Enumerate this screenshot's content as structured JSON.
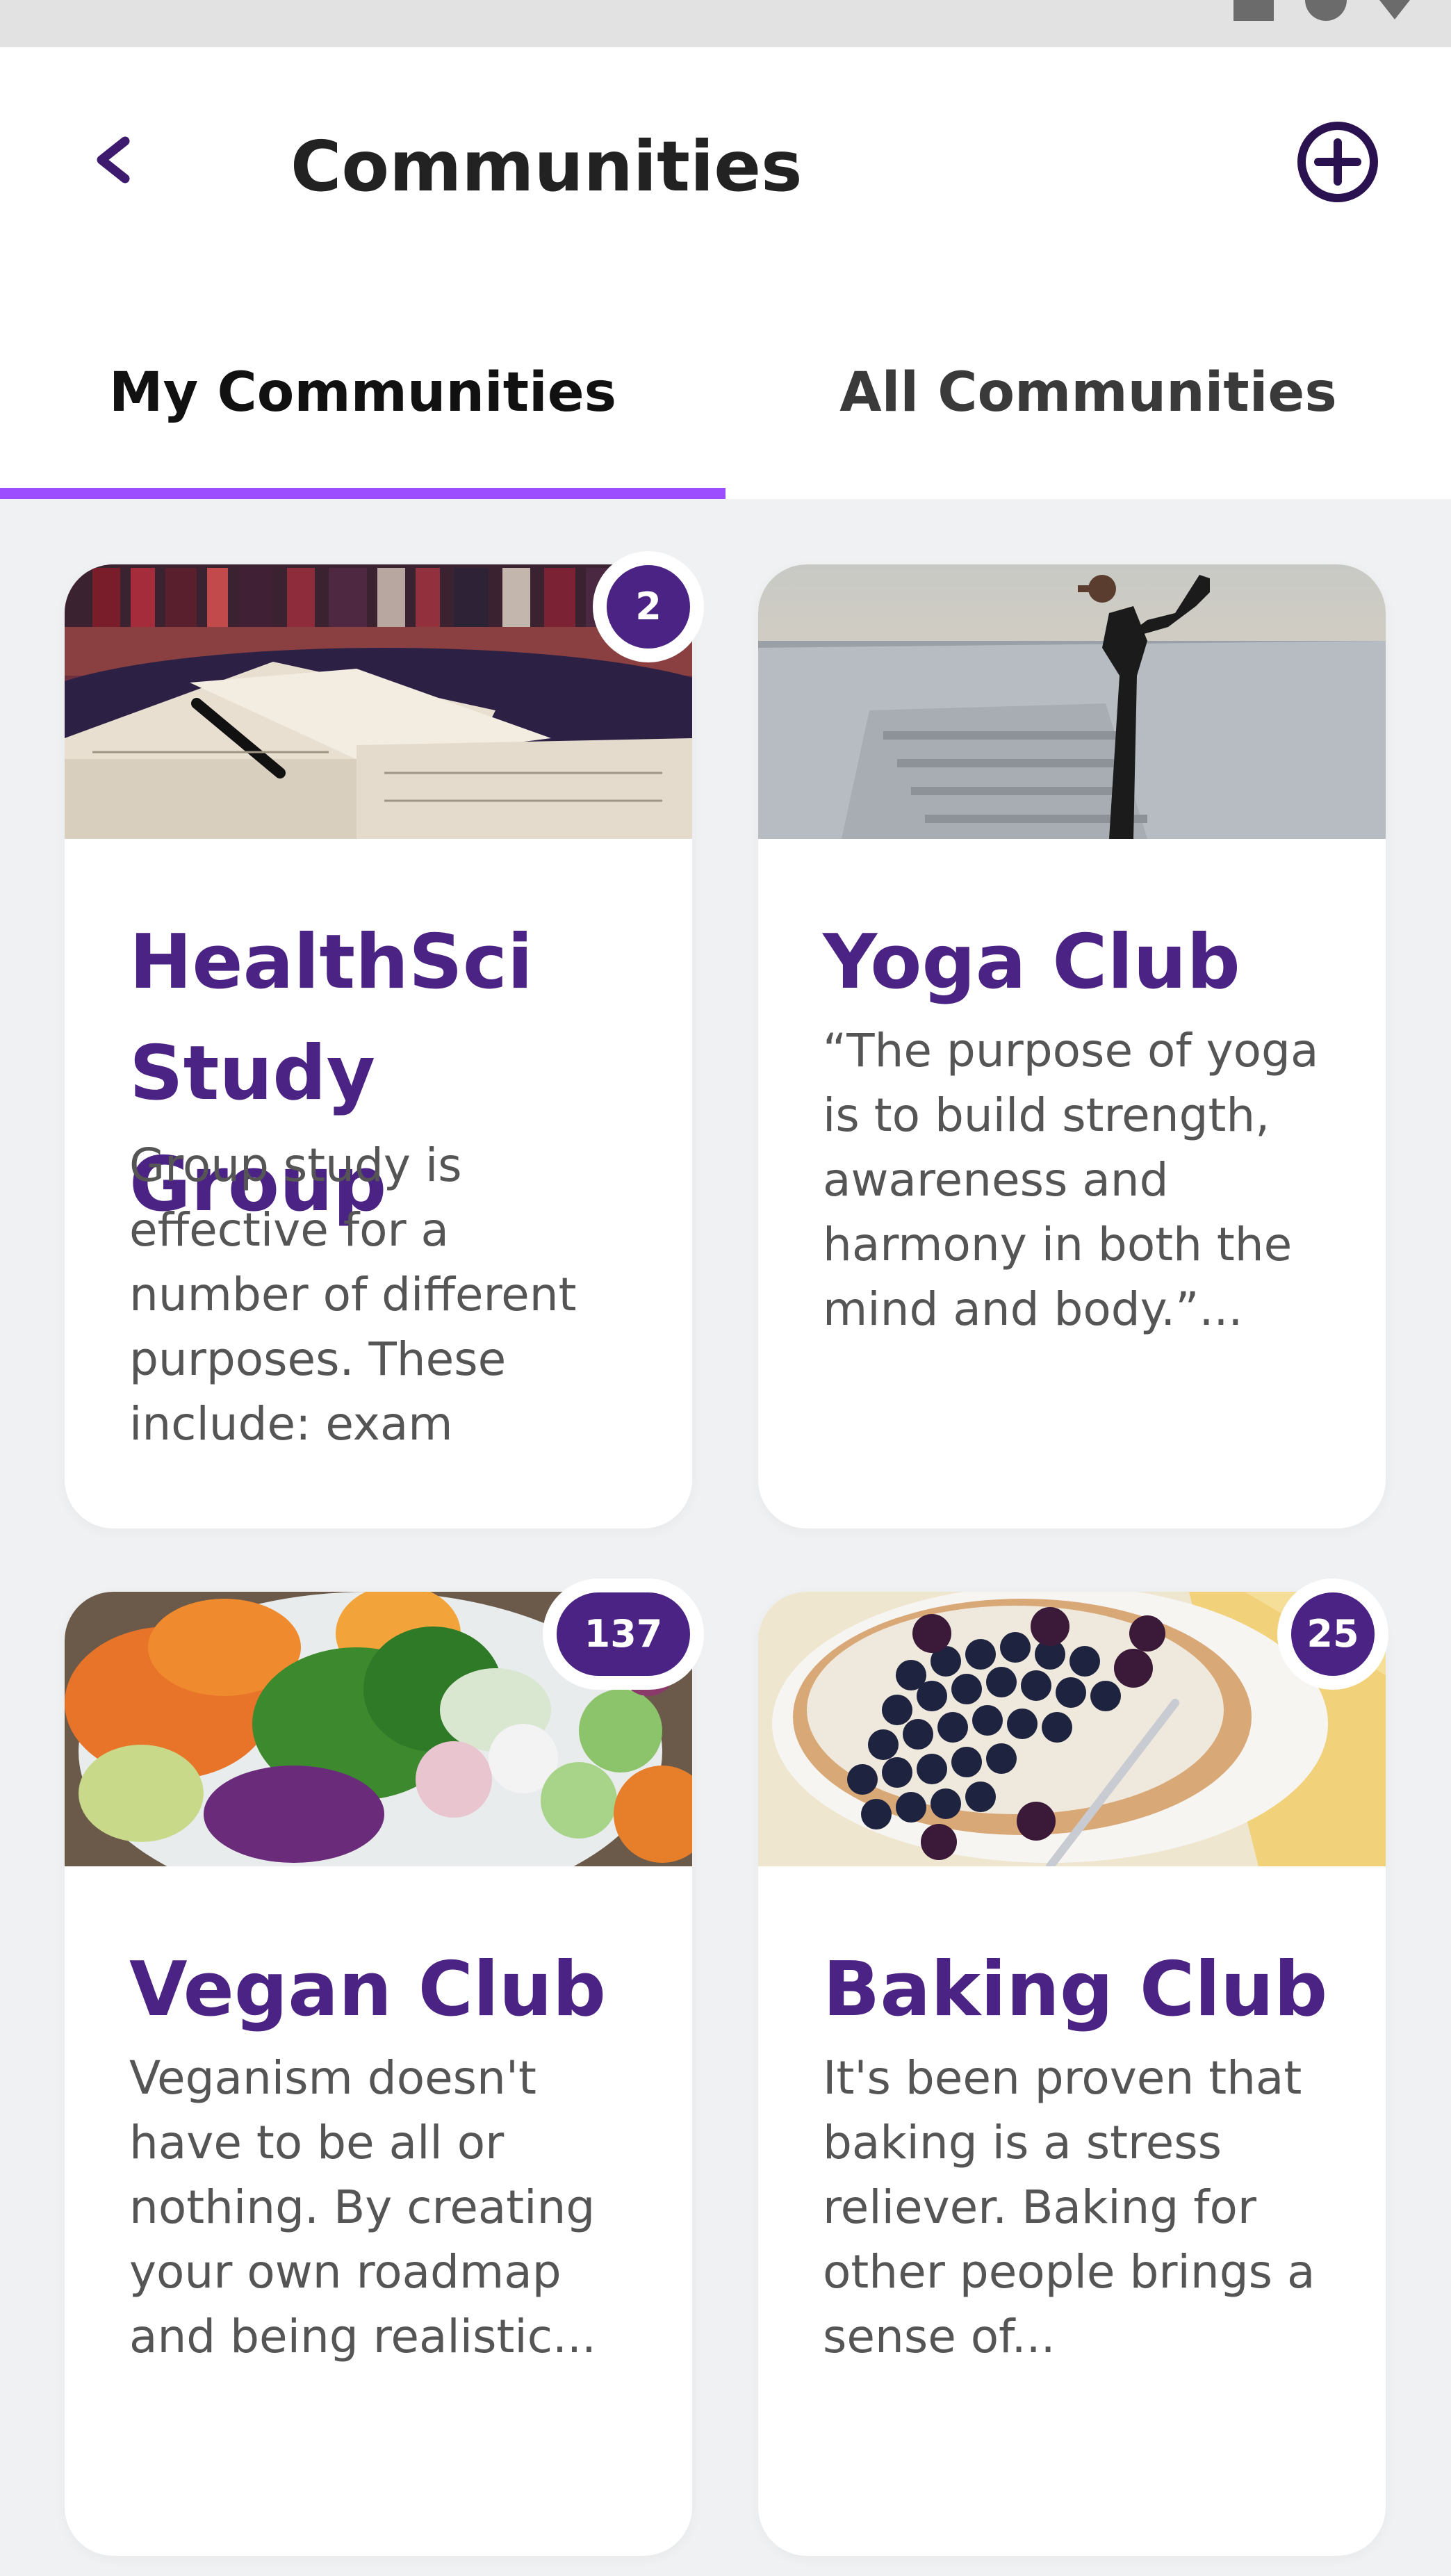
{
  "header": {
    "title": "Communities",
    "back_icon": "chevron-left-icon",
    "add_icon": "plus-circle-icon"
  },
  "tabs": [
    {
      "label": "My Communities",
      "active": true
    },
    {
      "label": "All Communities",
      "active": false
    }
  ],
  "colors": {
    "accent": "#9b4dff",
    "title_purple": "#4b2384",
    "background": "#f0f1f3"
  },
  "communities": [
    {
      "title_lines": [
        "HealthSci",
        "Study Group"
      ],
      "description_lines": [
        "Group study is",
        "effective for a",
        "number of different",
        "purposes. These",
        "include: exam"
      ],
      "badge": "2"
    },
    {
      "title_lines": [
        "Yoga Club"
      ],
      "description_lines": [
        "“The purpose of yoga",
        "is to build strength,",
        "awareness and",
        "harmony in both the",
        "mind and body.”..."
      ],
      "badge": ""
    },
    {
      "title_lines": [
        "Vegan Club"
      ],
      "description_lines": [
        "Veganism doesn't",
        "have to be all or",
        "nothing. By creating",
        "your own roadmap",
        "and being realistic..."
      ],
      "badge": "137"
    },
    {
      "title_lines": [
        "Baking Club"
      ],
      "description_lines": [
        "It's been proven that",
        "baking is a stress",
        "reliever. Baking for",
        "other people brings a",
        "sense of..."
      ],
      "badge": "25"
    }
  ]
}
